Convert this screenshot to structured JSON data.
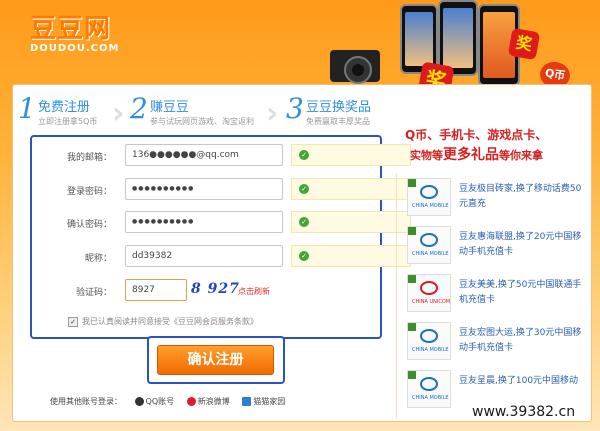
{
  "logo": {
    "cn": "豆豆网",
    "en": "DOUDOU.COM"
  },
  "steps": [
    {
      "num": "1",
      "title": "免费注册",
      "desc": "立即注册拿5Q币"
    },
    {
      "num": "2",
      "title": "赚豆豆",
      "desc": "参与试玩网页游戏、淘宝返利"
    },
    {
      "num": "3",
      "title": "豆豆换奖品",
      "desc": "免费赢取丰厚奖品"
    }
  ],
  "form": {
    "email_label": "我的邮箱：",
    "email_value": "136●●●●●●@qq.com",
    "password_label": "登录密码：",
    "password_value": "●●●●●●●●●●",
    "confirm_label": "确认密码：",
    "confirm_value": "●●●●●●●●●●",
    "nick_label": "昵称：",
    "nick_value": "dd39382",
    "captcha_label": "验证码：",
    "captcha_value": "8927",
    "captcha_image": "8 927",
    "refresh_label": "点击刷新",
    "agree_text": "我已认真阅读并同意接受《豆豆网会员服务条款》",
    "submit_label": "确认注册",
    "ok_icon": "check-icon"
  },
  "oauth": {
    "label": "使用其他账号登录：",
    "qq": "QQ账号",
    "weibo": "新浪微博",
    "mm": "猫猫家园"
  },
  "promo": {
    "slogan1": "Q币、手机卡、游戏点卡、",
    "slogan2_a": "实物等",
    "slogan2_b": "更多礼品",
    "slogan2_c": "等你来拿",
    "badge1": "奖",
    "badge2": "奖",
    "badge3": "Q币"
  },
  "winners": [
    {
      "text": "豆友极目砖家,换了移动话费50元直充",
      "logo": "CHINA MOBILE"
    },
    {
      "text": "豆友惠海联盟,换了20元中国移动手机充值卡",
      "logo": "CHINA MOBILE"
    },
    {
      "text": "豆友美美,换了50元中国联通手机充值卡",
      "logo": "CHINA UNICOM"
    },
    {
      "text": "豆友宏图大运,换了30元中国移动手机充值卡",
      "logo": "CHINA MOBILE"
    },
    {
      "text": "豆友呈晨,换了100元中国移动",
      "logo": "CHINA MOBILE"
    }
  ],
  "watermark": "www.39382.cn"
}
